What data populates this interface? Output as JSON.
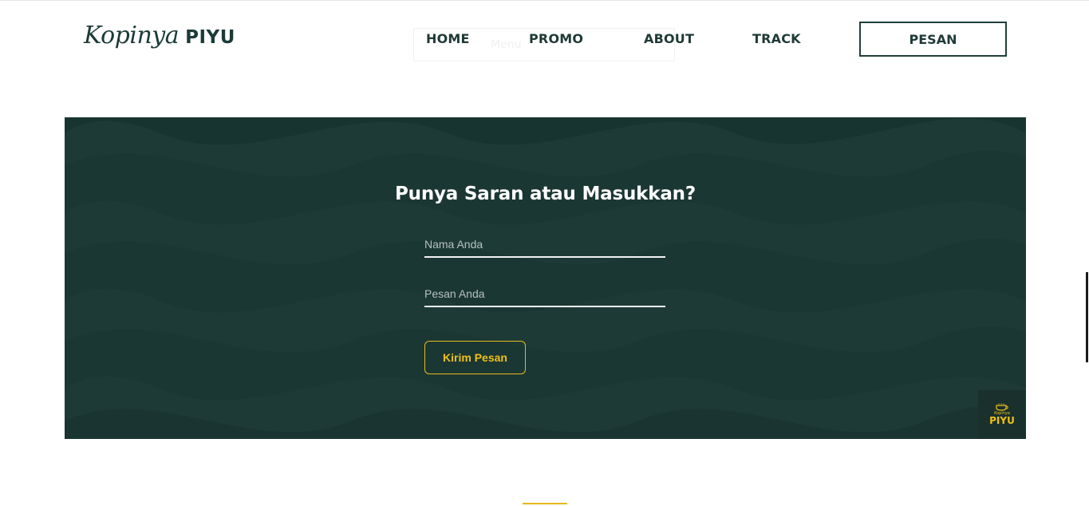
{
  "header": {
    "brand_script": "Kopinya",
    "brand_bold": "PIYU",
    "ghost_search": "Menu",
    "nav": [
      {
        "label": "HOME"
      },
      {
        "label": "PROMO"
      },
      {
        "label": "ABOUT"
      },
      {
        "label": "TRACK"
      }
    ],
    "cta_label": "PESAN"
  },
  "feedback": {
    "title": "Punya Saran atau Masukkan?",
    "name_placeholder": "Nama Anda",
    "name_value": "",
    "message_placeholder": "Pesan Anda",
    "message_value": "",
    "submit_label": "Kirim Pesan"
  },
  "corner_logo": {
    "small": "Kopinya",
    "big": "PIYU"
  },
  "colors": {
    "primary_dark": "#1d3a36",
    "accent_yellow": "#e8b820",
    "text_dark": "#1f3a36"
  }
}
